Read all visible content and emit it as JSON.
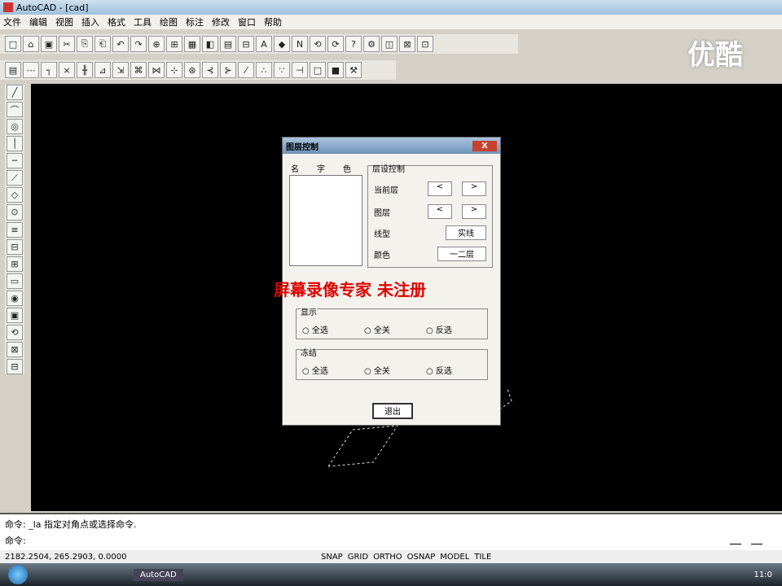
{
  "window": {
    "title": "AutoCAD - [cad]"
  },
  "menu": [
    "文件",
    "编辑",
    "视图",
    "插入",
    "格式",
    "工具",
    "绘图",
    "标注",
    "修改",
    "窗口",
    "帮助"
  ],
  "toolbar1": [
    "□",
    "⌂",
    "▣",
    "✂",
    "⎘",
    "⎗",
    "↶",
    "↷",
    "⊕",
    "⊞",
    "▦",
    "◧",
    "▤",
    "⊟",
    "A",
    "◆",
    "N",
    "⟲",
    "⟳",
    "?",
    "⚙",
    "◫",
    "⊠",
    "⊡"
  ],
  "toolbar2": [
    "▤",
    "⋯",
    "┐",
    "×",
    "╫",
    "⊿",
    "⇲",
    "⌘",
    "⋈",
    "⊹",
    "⊛",
    "⊰",
    "⊱",
    "⁄",
    "∴",
    "∵",
    "⊣",
    "□",
    "■",
    "⚒"
  ],
  "left_toolbar": [
    "╱",
    "⌒",
    "◎",
    "│",
    "─",
    "⟋",
    "◇",
    "⊙",
    "≡",
    "⊟",
    "⊞",
    "▭",
    "◉",
    "▣",
    "⟲",
    "⊠",
    "⊟"
  ],
  "dialog": {
    "title": "图层控制",
    "list_header": [
      "名",
      "字",
      "色"
    ],
    "section": "层设控制",
    "row1": "当前层",
    "row2": "图层",
    "row3": "线型",
    "row4": "颜色",
    "value3": "实线",
    "value4": "一二层",
    "prev": "<",
    "next": ">",
    "group1": "显示",
    "group2": "冻结",
    "opt1": "全选",
    "opt2": "全关",
    "opt3": "反选",
    "exit": "退出",
    "close": "X"
  },
  "watermark": "屏幕录像专家  未注册",
  "youku": "优酷",
  "command": {
    "line1": "命令: _la 指定对角点或选择命令.",
    "line2": "命令:"
  },
  "status": {
    "coords": "2182.2504, 265.2903, 0.0000",
    "modes": [
      "SNAP",
      "GRID",
      "ORTHO",
      "OSNAP",
      "MODEL",
      "TILE"
    ]
  },
  "taskbar": {
    "task": "AutoCAD",
    "time": "11:0"
  }
}
